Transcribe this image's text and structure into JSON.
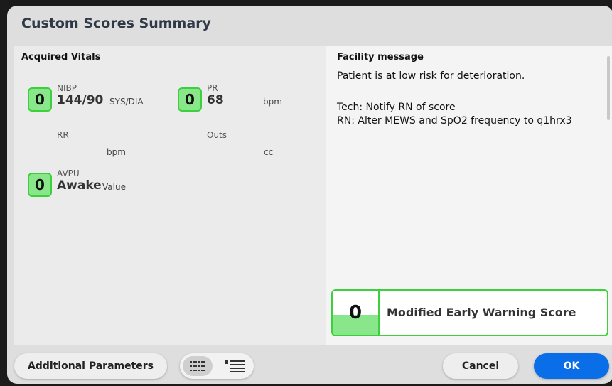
{
  "dialog": {
    "title": "Custom Scores Summary",
    "acquired_vitals_title": "Acquired Vitals",
    "facility_message_title": "Facility message"
  },
  "vitals": {
    "nibp": {
      "score": "0",
      "label": "NIBP",
      "value": "144/90",
      "unit": "SYS/DIA"
    },
    "pr": {
      "score": "0",
      "label": "PR",
      "value": "68",
      "unit": "bpm"
    },
    "rr": {
      "label": "RR",
      "unit": "bpm"
    },
    "outs": {
      "label": "Outs",
      "unit": "cc"
    },
    "avpu": {
      "score": "0",
      "label": "AVPU",
      "value": "Awake",
      "unit": "Value"
    }
  },
  "facility_message": {
    "line1": "Patient is at low risk for deterioration.",
    "line2": "Tech: Notify RN of score",
    "line3": "RN: Alter MEWS and SpO2 frequency to q1hrx3"
  },
  "mews": {
    "score": "0",
    "label": "Modified Early Warning Score"
  },
  "buttons": {
    "additional_parameters": "Additional Parameters",
    "cancel": "Cancel",
    "ok": "OK"
  },
  "view_toggle": {
    "left_icon": "grid-list-icon",
    "right_icon": "detail-list-icon",
    "selected": "left"
  },
  "colors": {
    "score_green_border": "#3cd13c",
    "score_green_fill": "#8ae68a",
    "ok_blue": "#0a6ee8"
  }
}
